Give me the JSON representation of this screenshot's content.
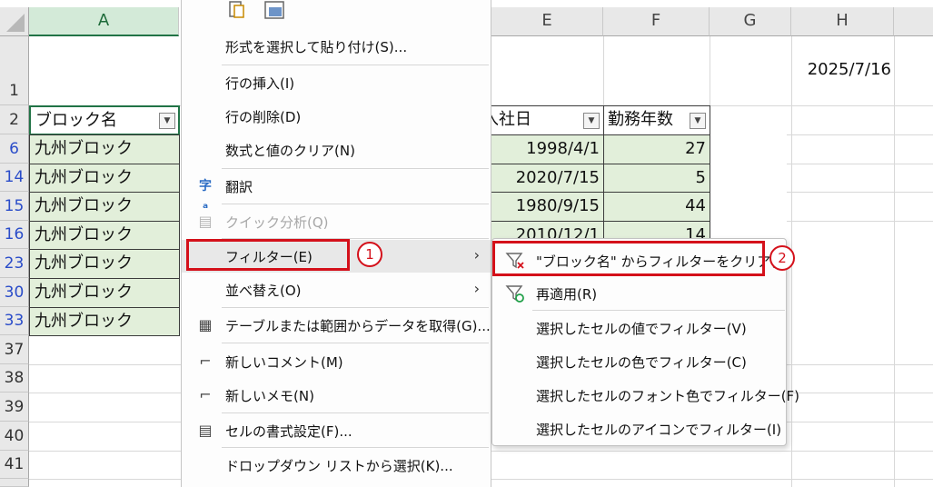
{
  "columns": [
    "A",
    "E",
    "F",
    "G",
    "H"
  ],
  "rows": [
    "1",
    "2",
    "6",
    "14",
    "15",
    "16",
    "23",
    "30",
    "33",
    "37",
    "38",
    "39",
    "40",
    "41"
  ],
  "date_cell": "2025/7/16",
  "header_cells": {
    "a": "ブロック名",
    "e": "入社日",
    "f": "勤務年数"
  },
  "data_rows": [
    {
      "a": "九州ブロック",
      "e": "1998/4/1",
      "f": "27"
    },
    {
      "a": "九州ブロック",
      "e": "2020/7/15",
      "f": "5"
    },
    {
      "a": "九州ブロック",
      "e": "1980/9/15",
      "f": "44"
    },
    {
      "a": "九州ブロック",
      "e": "2010/12/1",
      "f": "14"
    },
    {
      "a": "九州ブロック",
      "e": "",
      "f": ""
    },
    {
      "a": "九州ブロック",
      "e": "",
      "f": ""
    },
    {
      "a": "九州ブロック",
      "e": "",
      "f": ""
    }
  ],
  "context_menu": {
    "paste_special": "形式を選択して貼り付け(S)...",
    "insert_row": "行の挿入(I)",
    "delete_row": "行の削除(D)",
    "clear_contents": "数式と値のクリア(N)",
    "translate": "翻訳",
    "quick_analysis": "クイック分析(Q)",
    "filter": "フィルター(E)",
    "sort": "並べ替え(O)",
    "get_data": "テーブルまたは範囲からデータを取得(G)...",
    "new_comment": "新しいコメント(M)",
    "new_note": "新しいメモ(N)",
    "format_cells": "セルの書式設定(F)...",
    "pick_list": "ドロップダウン リストから選択(K)..."
  },
  "submenu": {
    "clear_filter": "\"ブロック名\" からフィルターをクリア(E)",
    "reapply": "再適用(R)",
    "by_value": "選択したセルの値でフィルター(V)",
    "by_color": "選択したセルの色でフィルター(C)",
    "by_font_color": "選択したセルのフォント色でフィルター(F)",
    "by_icon": "選択したセルのアイコンでフィルター(I)"
  },
  "badges": {
    "one": "1",
    "two": "2"
  },
  "colors": {
    "highlight": "#d4101a",
    "row_fill": "#e2efda",
    "header_accent": "#217346"
  }
}
